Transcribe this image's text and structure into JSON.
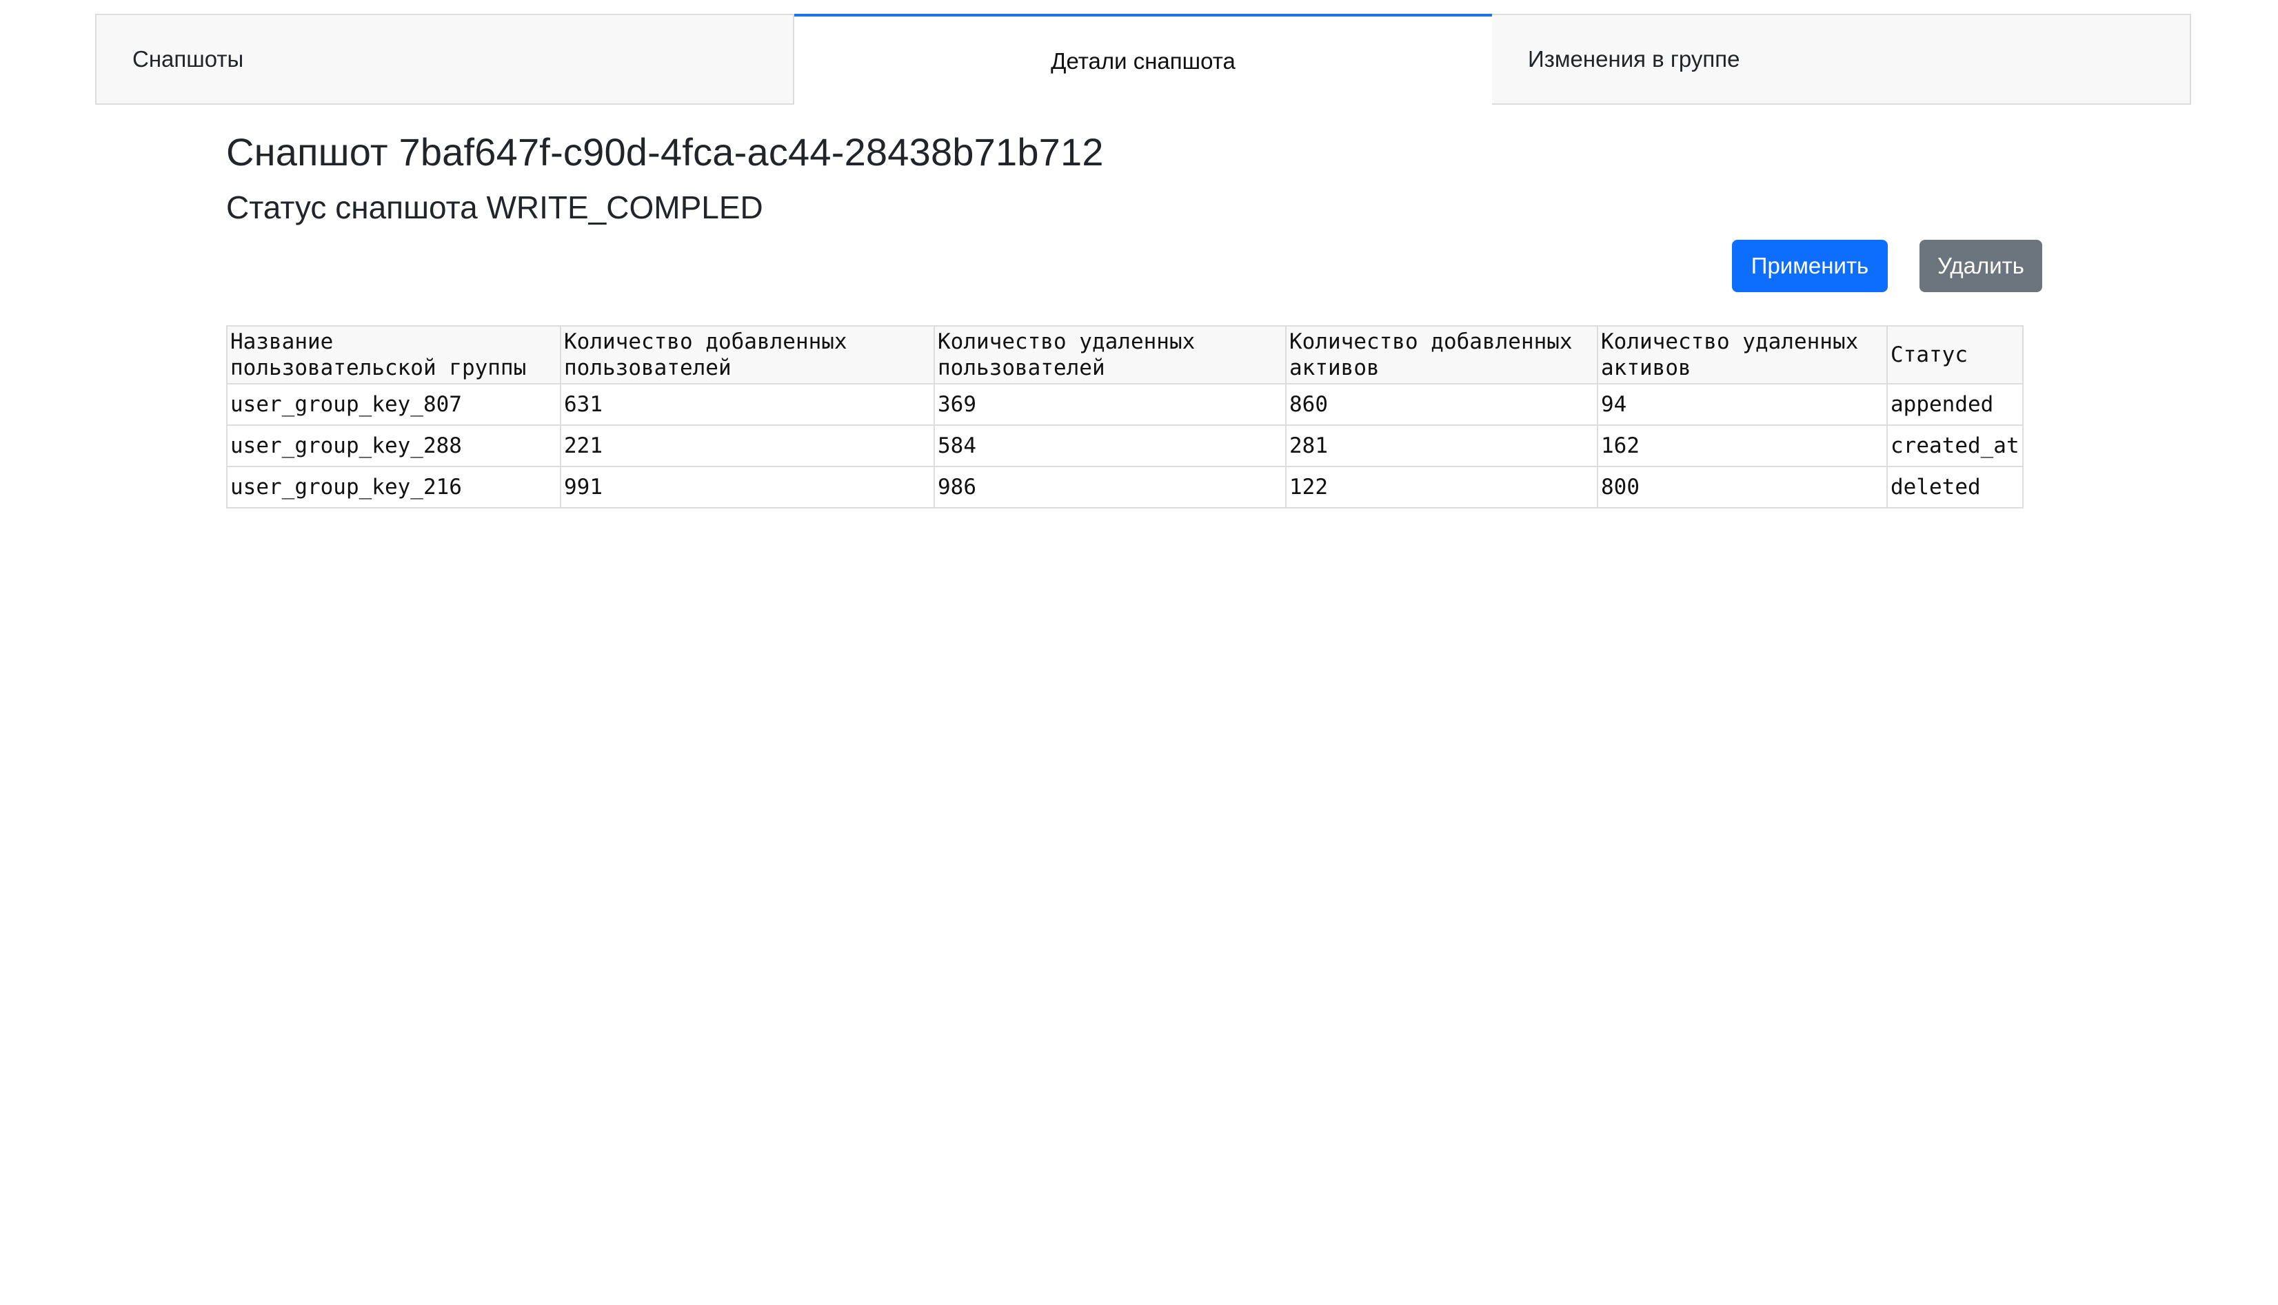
{
  "tabs": [
    {
      "label": "Снапшоты",
      "active": false
    },
    {
      "label": "Детали снапшота",
      "active": true
    },
    {
      "label": "Изменения в группе",
      "active": false
    }
  ],
  "title": "Снапшот 7baf647f-c90d-4fca-ac44-28438b71b712",
  "status_text": "Статус снапшота WRITE_COMPLED",
  "buttons": {
    "apply": "Применить",
    "delete": "Удалить"
  },
  "colors": {
    "accent": "#0d6efd",
    "secondary": "#6c757d",
    "active_tab_border": "#1a73e8"
  },
  "table": {
    "headers": [
      [
        "Название",
        "пользовательской группы"
      ],
      [
        "Количество добавленных",
        "пользователей"
      ],
      [
        "Количество удаленных",
        "пользователей"
      ],
      [
        "Количество добавленных",
        "активов"
      ],
      [
        "Количество удаленных",
        "активов"
      ],
      [
        "Статус"
      ]
    ],
    "rows": [
      [
        "user_group_key_807",
        "631",
        "369",
        "860",
        "94",
        "appended"
      ],
      [
        "user_group_key_288",
        "221",
        "584",
        "281",
        "162",
        "created_at"
      ],
      [
        "user_group_key_216",
        "991",
        "986",
        "122",
        "800",
        "deleted"
      ]
    ]
  }
}
